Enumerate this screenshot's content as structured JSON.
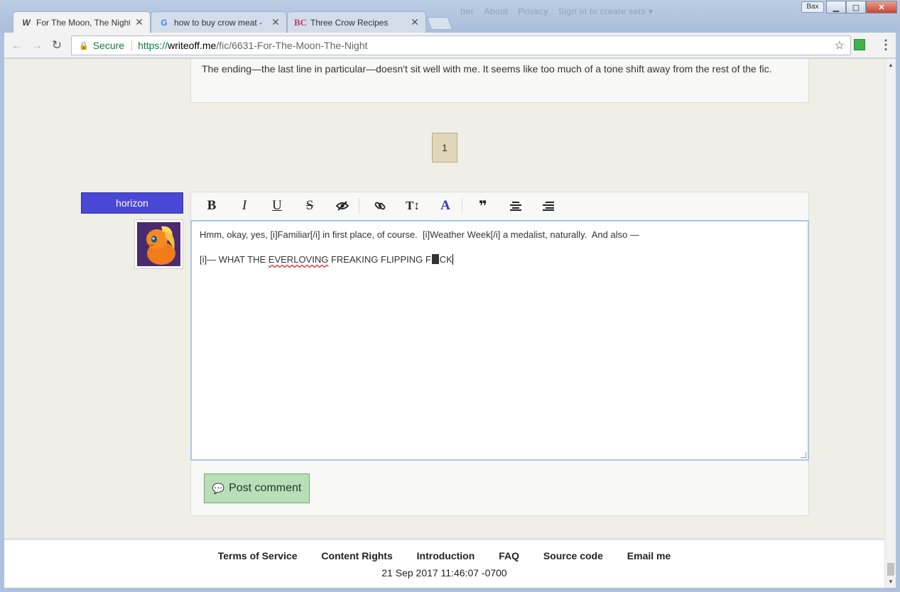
{
  "browser": {
    "profile": "Bax",
    "tabs": [
      {
        "title": "For The Moon, The Night",
        "favicon": "W",
        "active": true
      },
      {
        "title": "how to buy crow meat -",
        "favicon": "G",
        "active": false
      },
      {
        "title": "Three Crow Recipes",
        "favicon": "BC",
        "active": false
      }
    ],
    "bg_links": [
      "tter",
      "About",
      "Privacy",
      "Sign in to create sets ▾"
    ],
    "secure_label": "Secure",
    "url_scheme": "https://",
    "url_host": "writeoff.me",
    "url_path": "/fic/6631-For-The-Moon-The-Night"
  },
  "page": {
    "prev_comment": "The ending—the last line in particular—doesn't sit well with me. It seems like too much of a tone shift away from the rest of the fic.",
    "pager_current": "1",
    "username": "horizon",
    "editor": {
      "toolbar": [
        {
          "name": "bold",
          "glyph": "B"
        },
        {
          "name": "italic",
          "glyph": "I"
        },
        {
          "name": "underline",
          "glyph": "U"
        },
        {
          "name": "strikethrough",
          "glyph": "S"
        },
        {
          "name": "spoiler",
          "glyph": "✎"
        },
        {
          "name": "link",
          "glyph": "🔗"
        },
        {
          "name": "font-size",
          "glyph": "T↕"
        },
        {
          "name": "color",
          "glyph": "A"
        },
        {
          "name": "quote",
          "glyph": "❞"
        },
        {
          "name": "align-center",
          "glyph": "≡"
        },
        {
          "name": "align-right",
          "glyph": "≡"
        }
      ],
      "line1": "Hmm, okay, yes, [i]Familiar[/i] in first place, of course.  [i]Weather Week[/i] a medalist, naturally.  And also —",
      "line2_prefix": "[i]— WHAT THE ",
      "line2_misspelled": "EVERLOVING",
      "line2_middle": " FREAKING FLIPPING F",
      "line2_suffix": "CK"
    },
    "post_button": "Post comment"
  },
  "footer": {
    "links": [
      "Terms of Service",
      "Content Rights",
      "Introduction",
      "FAQ",
      "Source code",
      "Email me"
    ],
    "timestamp": "21 Sep 2017 11:46:07 -0700"
  }
}
